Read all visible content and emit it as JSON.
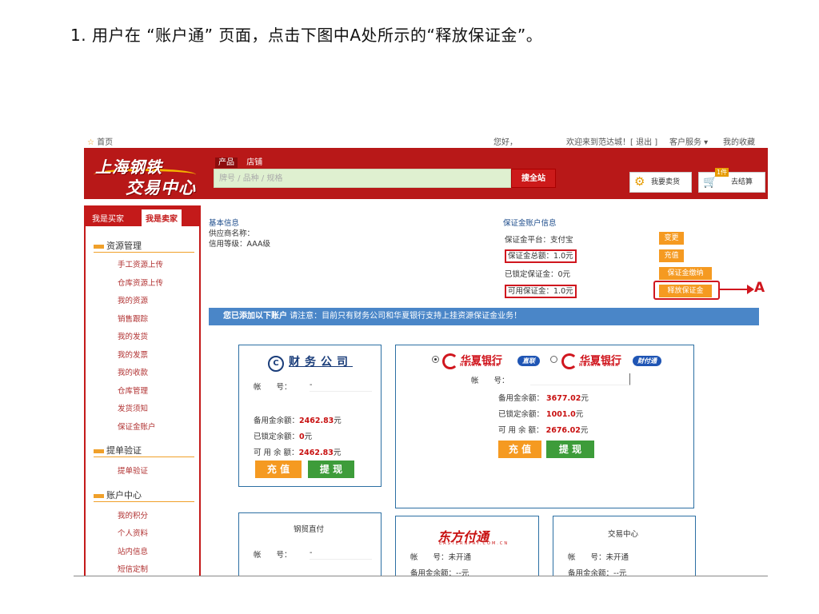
{
  "instruction": "1. 用户在 “账户通” 页面，点击下图中A处所示的“释放保证金”。",
  "topbar": {
    "home": "首页",
    "greeting": "您好，",
    "welcome": "欢迎来到范达城！[ 退出 ]",
    "service": "客户服务 ▾",
    "favorites": "我的收藏"
  },
  "header": {
    "logo_line1": "上海钢铁",
    "logo_line2": "交易中心",
    "tab_products": "产品",
    "tab_shops": "店铺",
    "search_placeholder": "牌号 / 品种 / 规格",
    "search_button": "搜全站",
    "sell_button": "我要卖货",
    "cart_count": "1件",
    "cart_button": "去结算"
  },
  "sidebar": {
    "tab_buyer": "我是买家",
    "tab_seller": "我是卖家",
    "sections": [
      {
        "title": "资源管理",
        "items": [
          "手工资源上传",
          "仓库资源上传",
          "我的资源",
          "销售跟踪",
          "我的发货",
          "我的发票",
          "我的收款",
          "仓库管理",
          "发货须知",
          "保证金账户"
        ]
      },
      {
        "title": "提单验证",
        "items": [
          "提单验证"
        ]
      },
      {
        "title": "账户中心",
        "items": [
          "我的积分",
          "个人资料",
          "站内信息",
          "短信定制"
        ]
      }
    ]
  },
  "basic_info": {
    "title": "基本信息",
    "supplier_label": "供应商名称：",
    "credit": "信用等级：AAA级"
  },
  "margin_info": {
    "title": "保证金账户信息",
    "platform": "保证金平台：支付宝",
    "total": "保证金总额：1.0元",
    "locked": "已锁定保证金：0元",
    "available": "可用保证金：1.0元",
    "btn_change": "变更",
    "btn_recharge": "充值",
    "btn_pay": "保证金缴纳",
    "btn_release": "释放保证金",
    "callout_letter": "A"
  },
  "accounts_bar": {
    "lead": "您已添加以下账户",
    "note": "请注意：目前只有财务公司和华夏银行支持上挂资源保证金业务！"
  },
  "card_finance": {
    "logo": "财务公司",
    "logo_mark": "C",
    "account_label": "帐　　号：",
    "account_value": "-",
    "reserve_label": "备用金余额：",
    "reserve_value": "2462.83",
    "locked_label": "已锁定余额：",
    "locked_value": "0",
    "available_label": "可 用 余 额：",
    "available_value": "2462.83",
    "unit": "元",
    "btn_recharge": "充 值",
    "btn_withdraw": "提 现"
  },
  "card_huaxia": {
    "bank_name": "华夏银行",
    "bank_en": "HUAXIA BANK",
    "pill_direct": "直联",
    "pill_pay": "财付通",
    "account_label": "帐　　号：",
    "reserve_label": "备用金余额：",
    "reserve_value": "3677.02",
    "locked_label": "已锁定余额：",
    "locked_value": "1001.0",
    "available_label": "可 用 余 额：",
    "available_value": "2676.02",
    "unit": "元",
    "btn_recharge": "充 值",
    "btn_withdraw": "提 现"
  },
  "card_steel": {
    "title": "钢贸直付",
    "account_label": "帐　　号：",
    "account_value": "-"
  },
  "card_dongfang": {
    "logo": "东方付通",
    "logo_sub": "EASTERNPAY.COM.CN",
    "account_label": "帐　　号：",
    "account_value": "未开通",
    "reserve_label": "备用金余额：",
    "reserve_value": "--元"
  },
  "card_exchange": {
    "title": "交易中心",
    "account_label": "帐　　号：",
    "account_value": "未开通",
    "reserve_label": "备用金余额：",
    "reserve_value": "--元"
  }
}
